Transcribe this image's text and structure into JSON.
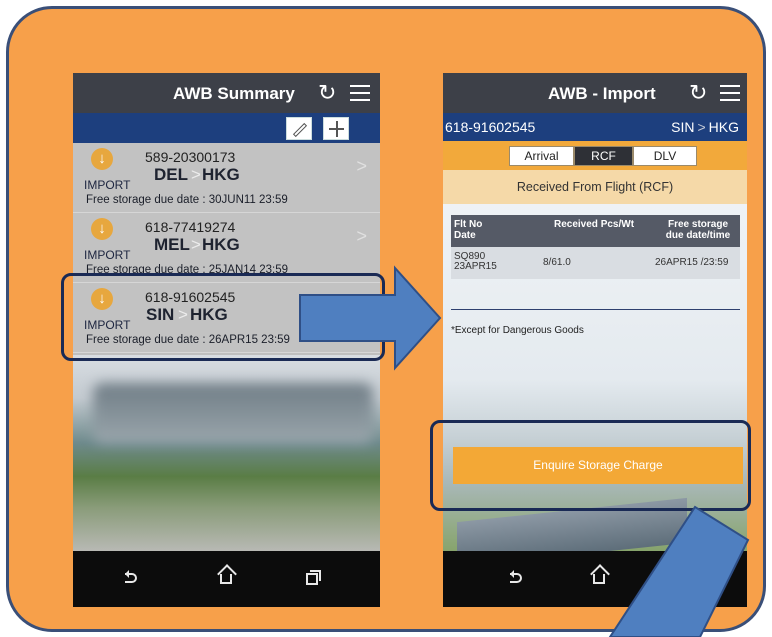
{
  "screen1": {
    "title": "AWB Summary",
    "items": [
      {
        "awb": "589-20300173",
        "type": "IMPORT",
        "from": "DEL",
        "sep": ">",
        "to": "HKG",
        "due": "Free storage due date : 30JUN11 23:59",
        "chevron": ">"
      },
      {
        "awb": "618-77419274",
        "type": "IMPORT",
        "from": "MEL",
        "sep": ">",
        "to": "HKG",
        "due": "Free storage due date : 25JAN14 23:59",
        "chevron": ">"
      },
      {
        "awb": "618-91602545",
        "type": "IMPORT",
        "from": "SIN",
        "sep": ">",
        "to": "HKG",
        "due": "Free storage due date : 26APR15 23:59",
        "chevron": ">"
      }
    ]
  },
  "screen2": {
    "title": "AWB - Import",
    "awb": "618-91602545",
    "route_from": "SIN",
    "route_sep": ">",
    "route_to": "HKG",
    "tabs": [
      "Arrival",
      "RCF",
      "DLV"
    ],
    "active_tab": "RCF",
    "section_title": "Received From Flight (RCF)",
    "table": {
      "headers": [
        "Flt No\nDate",
        "Received Pcs/Wt",
        "Free storage\ndue date/time"
      ],
      "rows": [
        [
          "SQ890\n23APR15",
          "8/61.0",
          "26APR15 /23:59"
        ]
      ]
    },
    "note": "*Except for Dangerous Goods",
    "enquire_button": "Enquire Storage Charge"
  },
  "icons": {
    "refresh": "refresh-icon",
    "menu": "menu-icon",
    "edit": "pencil-icon",
    "add": "plus-icon",
    "import": "down-arrow-icon",
    "back": "back-icon",
    "home": "home-icon",
    "recent": "recent-apps-icon"
  },
  "colors": {
    "panel": "#f7a04a",
    "title_bar": "#3d4048",
    "brand_blue": "#1d3f7e",
    "accent_orange": "#f3a836",
    "highlight_border": "#1a2a55",
    "arrow": "#4f7fc0"
  }
}
